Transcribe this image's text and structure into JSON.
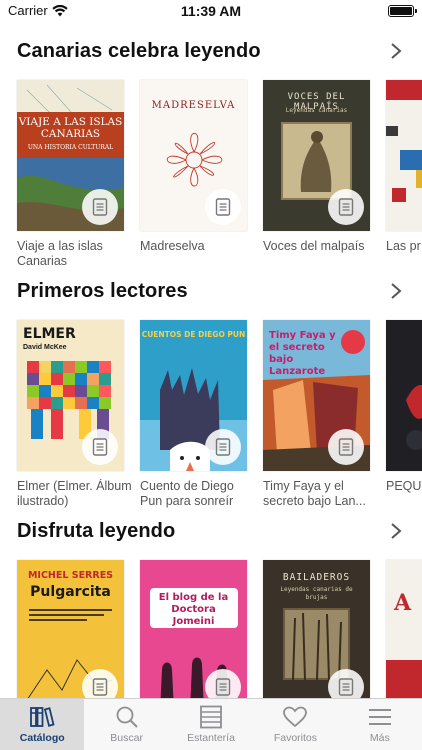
{
  "status_bar": {
    "carrier": "Carrier",
    "time": "11:39 AM"
  },
  "colors": {
    "accent": "#1a3f70",
    "tab_inactive": "#8e8e93"
  },
  "sections": [
    {
      "title": "Canarias celebra leyendo",
      "books": [
        {
          "label": "Viaje a las islas Canarias",
          "cover_title": "VIAJE A LAS ISLAS CANARIAS",
          "cover_subtitle": "UNA HISTORIA CULTURAL"
        },
        {
          "label": "Madreselva",
          "cover_title": "MADRESELVA"
        },
        {
          "label": "Voces del malpaís",
          "cover_title": "VOCES DEL MALPAÍS",
          "cover_subtitle": "Leyendas canarias"
        },
        {
          "label": "Las pr de Ma"
        }
      ]
    },
    {
      "title": "Primeros lectores",
      "books": [
        {
          "label": "Elmer (Elmer. Álbum ilustrado)",
          "cover_title": "ELMER",
          "cover_subtitle": "David McKee"
        },
        {
          "label": "Cuento de Diego Pun para sonreír",
          "cover_title": "CUENTOS DE DIEGO PUN"
        },
        {
          "label": "Timy Faya y el secreto bajo Lan...",
          "cover_title": "Timy Faya y el secreto bajo Lanzarote"
        },
        {
          "label": "PEQUE GRAN"
        }
      ]
    },
    {
      "title": "Disfruta leyendo",
      "books": [
        {
          "label": "",
          "cover_title": "Pulgarcita",
          "cover_subtitle": "MICHEL SERRES"
        },
        {
          "label": "",
          "cover_title": "El blog de la Doctora Jomeini"
        },
        {
          "label": "",
          "cover_title": "BAILADEROS",
          "cover_subtitle": "Leyendas canarias de brujas"
        },
        {
          "label": ""
        }
      ]
    }
  ],
  "tabbar": [
    {
      "label": "Catálogo",
      "icon": "books-icon",
      "active": true
    },
    {
      "label": "Buscar",
      "icon": "search-icon",
      "active": false
    },
    {
      "label": "Estantería",
      "icon": "shelf-icon",
      "active": false
    },
    {
      "label": "Favoritos",
      "icon": "heart-icon",
      "active": false
    },
    {
      "label": "Más",
      "icon": "menu-icon",
      "active": false
    }
  ]
}
